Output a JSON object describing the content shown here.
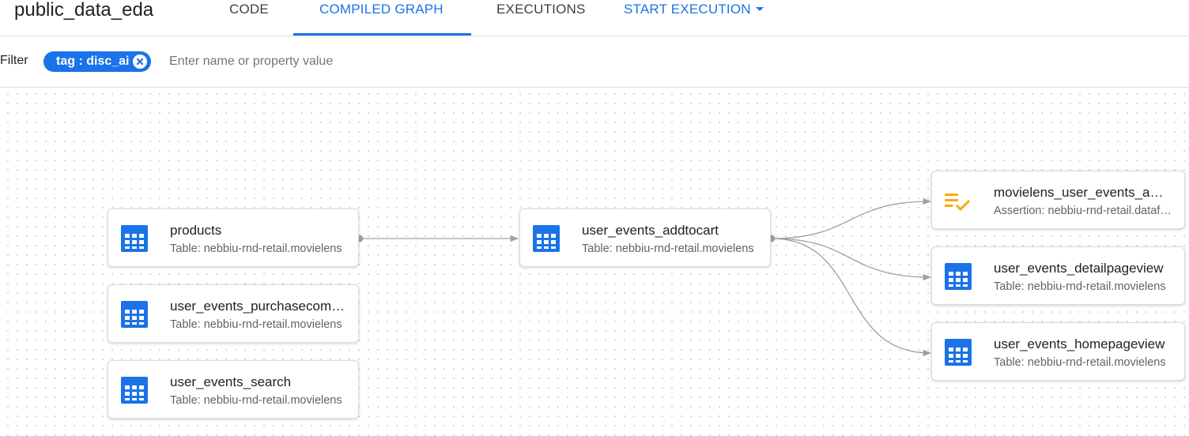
{
  "header": {
    "title": "public_data_eda",
    "tabs": [
      {
        "label": "CODE"
      },
      {
        "label": "COMPILED GRAPH"
      },
      {
        "label": "EXECUTIONS"
      }
    ],
    "start_execution": "START EXECUTION",
    "active_tab": "COMPILED GRAPH"
  },
  "filter": {
    "label": "Filter",
    "chip": "tag : disc_ai",
    "placeholder": "Enter name or property value"
  },
  "colors": {
    "accent": "#1a73e8",
    "assertion": "#f9ab00",
    "edge": "#9aa0a6"
  },
  "nodes": [
    {
      "id": "products",
      "name": "products",
      "subtitle": "Table: nebbiu-rnd-retail.movielens",
      "icon": "table-icon"
    },
    {
      "id": "purchase",
      "name": "user_events_purchasecomplete",
      "subtitle": "Table: nebbiu-rnd-retail.movielens",
      "icon": "table-icon"
    },
    {
      "id": "search",
      "name": "user_events_search",
      "subtitle": "Table: nebbiu-rnd-retail.movielens",
      "icon": "table-icon"
    },
    {
      "id": "addtocart",
      "name": "user_events_addtocart",
      "subtitle": "Table: nebbiu-rnd-retail.movielens",
      "icon": "table-icon"
    },
    {
      "id": "assertion",
      "name": "movielens_user_events_assertion",
      "subtitle": "Assertion: nebbiu-rnd-retail.dataform",
      "icon": "assertion-icon"
    },
    {
      "id": "detailpage",
      "name": "user_events_detailpageview",
      "subtitle": "Table: nebbiu-rnd-retail.movielens",
      "icon": "table-icon"
    },
    {
      "id": "homepage",
      "name": "user_events_homepageview",
      "subtitle": "Table: nebbiu-rnd-retail.movielens",
      "icon": "table-icon"
    }
  ]
}
